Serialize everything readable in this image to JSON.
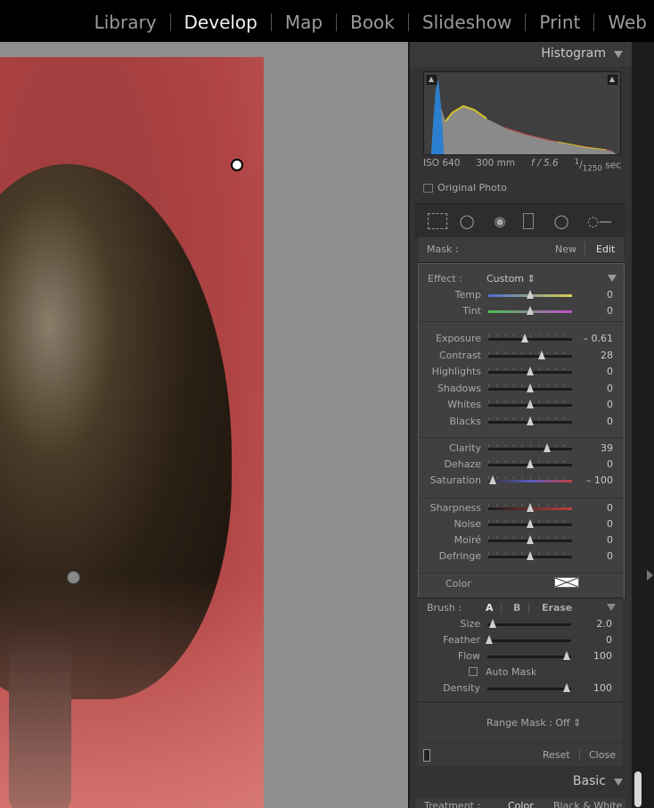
{
  "modules": [
    "Library",
    "Develop",
    "Map",
    "Book",
    "Slideshow",
    "Print",
    "Web"
  ],
  "active_module": "Develop",
  "histogram": {
    "title": "Histogram",
    "iso": "ISO 640",
    "focal": "300 mm",
    "aperture": "f / 5.6",
    "shutter_num": "1",
    "shutter_den": "1250",
    "shutter_unit": "sec",
    "original_photo": "Original Photo"
  },
  "mask": {
    "label": "Mask :",
    "new": "New",
    "edit": "Edit"
  },
  "effect": {
    "label": "Effect :",
    "value": "Custom"
  },
  "sliders_wb": [
    {
      "label": "Temp",
      "value": "0",
      "pos": 0.5
    },
    {
      "label": "Tint",
      "value": "0",
      "pos": 0.5
    }
  ],
  "sliders_tone": [
    {
      "label": "Exposure",
      "value": "– 0.61",
      "pos": 0.44
    },
    {
      "label": "Contrast",
      "value": "28",
      "pos": 0.64
    },
    {
      "label": "Highlights",
      "value": "0",
      "pos": 0.5
    },
    {
      "label": "Shadows",
      "value": "0",
      "pos": 0.5
    },
    {
      "label": "Whites",
      "value": "0",
      "pos": 0.5
    },
    {
      "label": "Blacks",
      "value": "0",
      "pos": 0.5
    }
  ],
  "sliders_presence": [
    {
      "label": "Clarity",
      "value": "39",
      "pos": 0.7
    },
    {
      "label": "Dehaze",
      "value": "0",
      "pos": 0.5
    },
    {
      "label": "Saturation",
      "value": "– 100",
      "pos": 0.05
    }
  ],
  "sliders_detail": [
    {
      "label": "Sharpness",
      "value": "0",
      "pos": 0.5
    },
    {
      "label": "Noise",
      "value": "0",
      "pos": 0.5
    },
    {
      "label": "Moiré",
      "value": "0",
      "pos": 0.5
    },
    {
      "label": "Defringe",
      "value": "0",
      "pos": 0.5
    }
  ],
  "color_label": "Color",
  "brush": {
    "label": "Brush :",
    "a": "A",
    "b": "B",
    "erase": "Erase",
    "size": {
      "label": "Size",
      "value": "2.0",
      "pos": 0.06
    },
    "feather": {
      "label": "Feather",
      "value": "0",
      "pos": 0.02
    },
    "flow": {
      "label": "Flow",
      "value": "100",
      "pos": 0.95
    },
    "auto_mask": "Auto Mask",
    "density": {
      "label": "Density",
      "value": "100",
      "pos": 0.95
    }
  },
  "range_mask": "Range Mask : Off",
  "footer": {
    "reset": "Reset",
    "close": "Close"
  },
  "basic": {
    "title": "Basic",
    "treatment": "Treatment :",
    "color": "Color",
    "bw": "Black & White"
  }
}
